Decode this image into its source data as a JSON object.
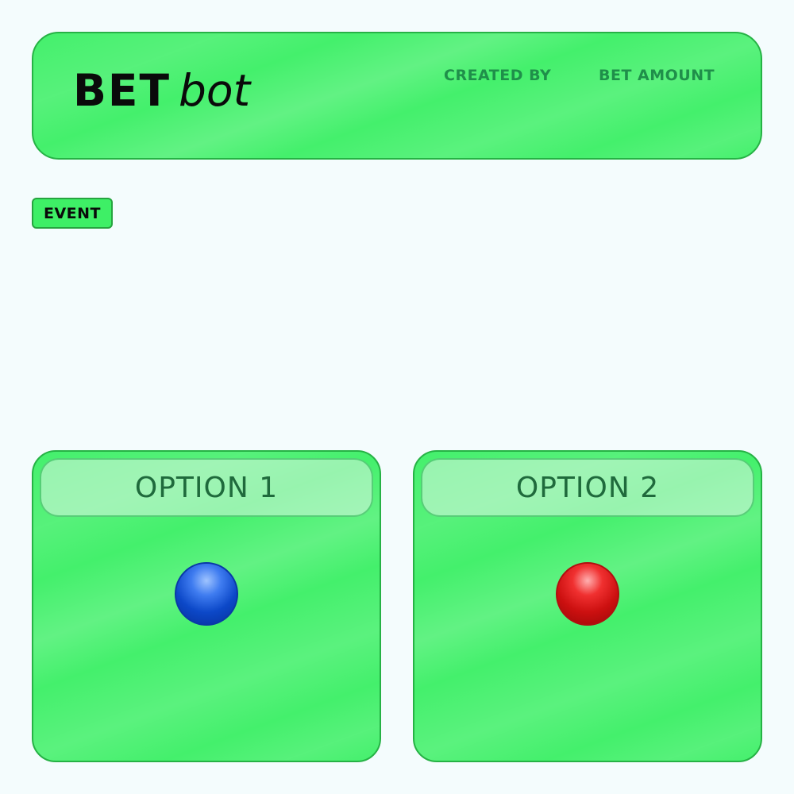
{
  "brand": {
    "bold": "BET",
    "italic": "bot"
  },
  "nav": {
    "created_by": "CREATED BY",
    "bet_amount": "BET AMOUNT"
  },
  "event": {
    "label": "EVENT"
  },
  "options": [
    {
      "title": "OPTION 1",
      "indicator": "blue-dot-icon",
      "color": "#0c48c8"
    },
    {
      "title": "OPTION 2",
      "indicator": "red-dot-icon",
      "color": "#cc1010"
    }
  ],
  "colors": {
    "background": "#f4fcfd",
    "panel_green": "#44f06c",
    "panel_border": "#26b245",
    "nav_text": "#1f8f4a",
    "option_title_text": "#1f6a3c"
  }
}
